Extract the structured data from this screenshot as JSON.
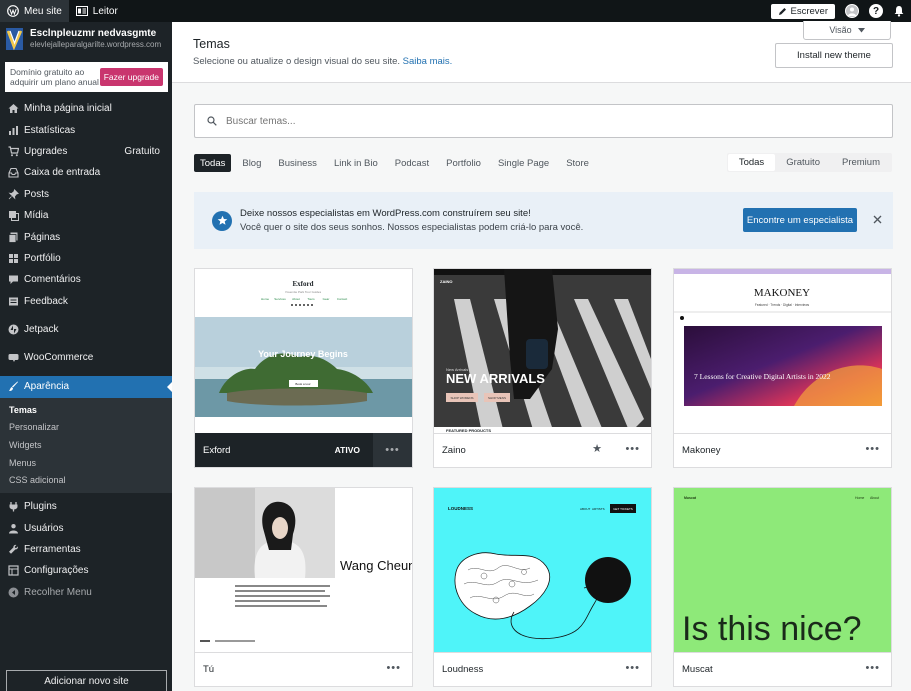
{
  "adminbar": {
    "my_site": "Meu site",
    "reader": "Leitor",
    "write": "Escrever"
  },
  "sidebar": {
    "site_name": "Esclnpleuzmr nedvasgmte",
    "site_url": "elevlejalleparalgarilte.wordpress.com",
    "upgrade_text": "Domínio gratuito ao adquirir um plano anual",
    "upgrade_button": "Fazer upgrade",
    "items": [
      {
        "label": "Minha página inicial",
        "icon": "home-icon"
      },
      {
        "label": "Estatísticas",
        "icon": "stats-icon"
      },
      {
        "label": "Upgrades",
        "icon": "cart-icon",
        "extra": "Gratuito"
      },
      {
        "label": "Caixa de entrada",
        "icon": "inbox-icon"
      },
      {
        "label": "Posts",
        "icon": "pin-icon"
      },
      {
        "label": "Mídia",
        "icon": "media-icon"
      },
      {
        "label": "Páginas",
        "icon": "pages-icon"
      },
      {
        "label": "Portfólio",
        "icon": "portfolio-icon"
      },
      {
        "label": "Comentários",
        "icon": "comment-icon"
      },
      {
        "label": "Feedback",
        "icon": "feedback-icon"
      },
      {
        "label": "Jetpack",
        "icon": "jetpack-icon"
      },
      {
        "label": "WooCommerce",
        "icon": "woo-icon"
      },
      {
        "label": "Aparência",
        "icon": "brush-icon"
      },
      {
        "label": "Plugins",
        "icon": "plugin-icon"
      },
      {
        "label": "Usuários",
        "icon": "users-icon"
      },
      {
        "label": "Ferramentas",
        "icon": "wrench-icon"
      },
      {
        "label": "Configurações",
        "icon": "settings-icon"
      },
      {
        "label": "Recolher Menu",
        "icon": "collapse-icon"
      }
    ],
    "submenu": [
      "Temas",
      "Personalizar",
      "Widgets",
      "Menus",
      "CSS adicional"
    ],
    "add_site": "Adicionar novo site"
  },
  "header": {
    "title": "Temas",
    "subtitle": "Selecione ou atualize o design visual do seu site.",
    "learn_more": "Saiba mais.",
    "view": "Visão",
    "install": "Install new theme"
  },
  "search": {
    "placeholder": "Buscar temas..."
  },
  "filters": [
    "Todas",
    "Blog",
    "Business",
    "Link in Bio",
    "Podcast",
    "Portfolio",
    "Single Page",
    "Store"
  ],
  "price_filters": [
    "Todas",
    "Gratuito",
    "Premium"
  ],
  "banner": {
    "title": "Deixe nossos especialistas em WordPress.com construírem seu site!",
    "desc": "Você quer o site dos seus sonhos. Nossos especialistas podem criá-lo para você.",
    "button": "Encontre um especialista"
  },
  "themes": [
    {
      "name": "Exford",
      "status": "ATIVO",
      "preview": {
        "logo": "Exford",
        "tagline": "Yosemite Park Tour Guides",
        "nav": [
          "Home",
          "Services",
          "About",
          "Tours",
          "Gear",
          "Contact"
        ],
        "hero": "Your Journey Begins",
        "cta": "Book a tour"
      }
    },
    {
      "name": "Zaino",
      "preview": {
        "logo": "ZAINO",
        "kicker": "New Arrivals",
        "hero": "NEW ARRIVALS",
        "button1": "SHOP WOMENS",
        "button2": "SHOP MENS",
        "section": "FEATURED PRODUCTS"
      }
    },
    {
      "name": "Makoney",
      "preview": {
        "logo": "MAKONEY",
        "nav": "Featured · Trends · Digital · Interviews",
        "hero": "7 Lessons for Creative Digital Artists in 2022"
      }
    },
    {
      "name": "Tú",
      "preview": {
        "hero": "Wang Cheung"
      }
    },
    {
      "name": "Loudness",
      "preview": {
        "logo": "LOUDNESS",
        "nav1": "ABOUT",
        "nav2": "ARTISTS",
        "button": "GET TICKETS"
      }
    },
    {
      "name": "Muscat",
      "preview": {
        "logo": "Muscat",
        "nav1": "Home",
        "nav2": "About",
        "hero": "Is this nice?"
      }
    }
  ],
  "colors": {
    "admin_bar": "#101517",
    "sidebar": "#1d2327",
    "accent": "#2271b1",
    "upgrade": "#c9356e",
    "loudness_bg": "#4ff4f9",
    "muscat_bg": "#8ee979"
  }
}
